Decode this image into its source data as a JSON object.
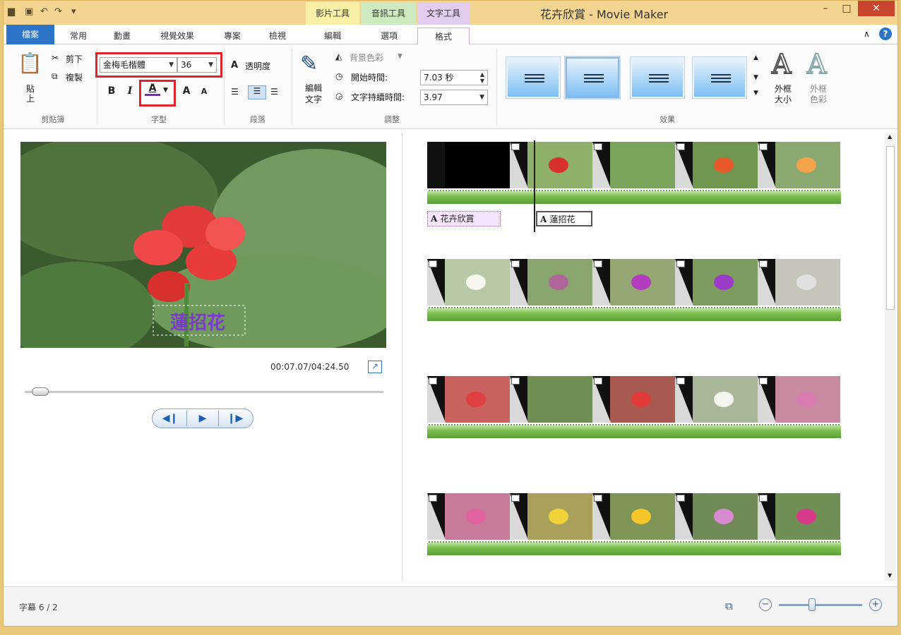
{
  "window": {
    "title": "花卉欣賞 - Movie Maker",
    "contextual_tabs": [
      "影片工具",
      "音訊工具",
      "文字工具"
    ],
    "controls": {
      "minimize": "–",
      "maximize": "□",
      "close": "✕"
    }
  },
  "ribbon": {
    "tabs": [
      "檔案",
      "常用",
      "動畫",
      "視覺效果",
      "專案",
      "檢視",
      "編輯",
      "選項",
      "格式"
    ],
    "active_tab": "格式",
    "clipboard": {
      "paste": "貼上",
      "cut": "剪下",
      "copy": "複製",
      "group": "剪貼簿"
    },
    "font": {
      "family": "金梅毛楷體",
      "size": "36",
      "bold": "B",
      "italic": "I",
      "color_letter": "A",
      "grow": "A",
      "shrink": "A",
      "group": "字型",
      "highlight_color": "#e0242c"
    },
    "paragraph": {
      "transparency": "透明度",
      "group": "段落"
    },
    "adjust": {
      "edit_text": "編輯文字",
      "background_color": "背景色彩",
      "start_time_label": "開始時間:",
      "start_time_value": "7.03 秒",
      "duration_label": "文字持續時間:",
      "duration_value": "3.97",
      "group": "調整"
    },
    "effects": {
      "group": "效果",
      "outline_size": "外框\n大小",
      "outline_color": "外框\n色彩"
    }
  },
  "preview": {
    "overlay_text": "蓮招花",
    "time_readout": "00:07.07/04:24.50",
    "seek_fraction": 0.027
  },
  "storyboard": {
    "captions": [
      "花卉欣賞",
      "蓮招花"
    ]
  },
  "statusbar": {
    "text": "字幕 6 / 2"
  }
}
